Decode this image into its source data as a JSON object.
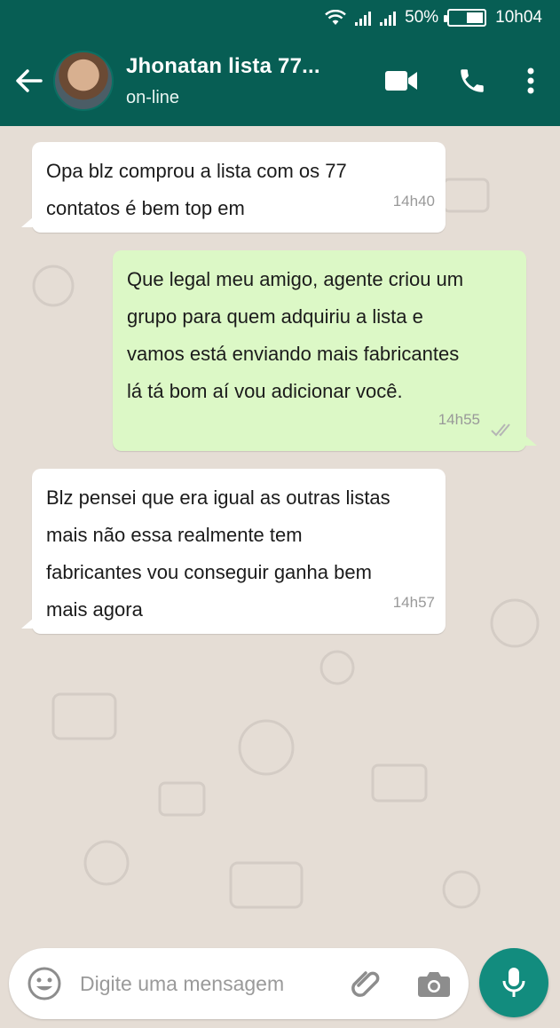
{
  "status_bar": {
    "battery_percent": "50%",
    "time": "10h04",
    "battery_level": 0.5
  },
  "header": {
    "contact_name": "Jhonatan lista 77...",
    "status": "on-line",
    "icons": [
      "back-arrow-icon",
      "video-call-icon",
      "phone-icon",
      "more-options-icon"
    ]
  },
  "messages": [
    {
      "direction": "in",
      "text_lines": [
        "Opa blz comprou a lista com os 77",
        "contatos é bem top em"
      ],
      "time": "14h40"
    },
    {
      "direction": "out",
      "text_lines": [
        "Que legal meu amigo, agente criou um",
        "grupo para quem adquiriu a lista e",
        "vamos está enviando mais fabricantes",
        "lá tá bom aí vou adicionar você."
      ],
      "time": "14h55",
      "status": "read"
    },
    {
      "direction": "in",
      "text_lines": [
        "Blz pensei que era igual as outras listas",
        "mais não essa realmente tem",
        "fabricantes vou conseguir ganha bem",
        "mais agora"
      ],
      "time": "14h57"
    }
  ],
  "composer": {
    "placeholder": "Digite uma mensagem",
    "icons": [
      "emoji-icon",
      "attach-icon",
      "camera-icon",
      "mic-icon"
    ]
  },
  "colors": {
    "header": "#075e54",
    "chat_background": "#e5ddd5",
    "outgoing_bubble": "#dcf8c6",
    "incoming_bubble": "#ffffff",
    "mic_button": "#128c7e"
  }
}
